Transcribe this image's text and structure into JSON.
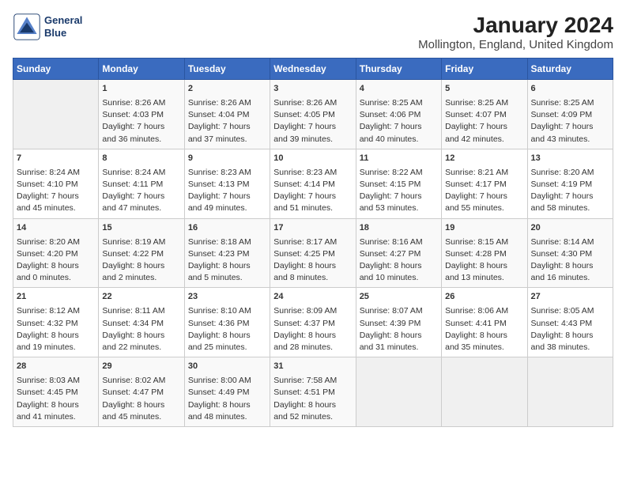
{
  "header": {
    "logo_line1": "General",
    "logo_line2": "Blue",
    "title": "January 2024",
    "subtitle": "Mollington, England, United Kingdom"
  },
  "calendar": {
    "days_of_week": [
      "Sunday",
      "Monday",
      "Tuesday",
      "Wednesday",
      "Thursday",
      "Friday",
      "Saturday"
    ],
    "weeks": [
      [
        {
          "day": "",
          "info": ""
        },
        {
          "day": "1",
          "info": "Sunrise: 8:26 AM\nSunset: 4:03 PM\nDaylight: 7 hours\nand 36 minutes."
        },
        {
          "day": "2",
          "info": "Sunrise: 8:26 AM\nSunset: 4:04 PM\nDaylight: 7 hours\nand 37 minutes."
        },
        {
          "day": "3",
          "info": "Sunrise: 8:26 AM\nSunset: 4:05 PM\nDaylight: 7 hours\nand 39 minutes."
        },
        {
          "day": "4",
          "info": "Sunrise: 8:25 AM\nSunset: 4:06 PM\nDaylight: 7 hours\nand 40 minutes."
        },
        {
          "day": "5",
          "info": "Sunrise: 8:25 AM\nSunset: 4:07 PM\nDaylight: 7 hours\nand 42 minutes."
        },
        {
          "day": "6",
          "info": "Sunrise: 8:25 AM\nSunset: 4:09 PM\nDaylight: 7 hours\nand 43 minutes."
        }
      ],
      [
        {
          "day": "7",
          "info": "Sunrise: 8:24 AM\nSunset: 4:10 PM\nDaylight: 7 hours\nand 45 minutes."
        },
        {
          "day": "8",
          "info": "Sunrise: 8:24 AM\nSunset: 4:11 PM\nDaylight: 7 hours\nand 47 minutes."
        },
        {
          "day": "9",
          "info": "Sunrise: 8:23 AM\nSunset: 4:13 PM\nDaylight: 7 hours\nand 49 minutes."
        },
        {
          "day": "10",
          "info": "Sunrise: 8:23 AM\nSunset: 4:14 PM\nDaylight: 7 hours\nand 51 minutes."
        },
        {
          "day": "11",
          "info": "Sunrise: 8:22 AM\nSunset: 4:15 PM\nDaylight: 7 hours\nand 53 minutes."
        },
        {
          "day": "12",
          "info": "Sunrise: 8:21 AM\nSunset: 4:17 PM\nDaylight: 7 hours\nand 55 minutes."
        },
        {
          "day": "13",
          "info": "Sunrise: 8:20 AM\nSunset: 4:19 PM\nDaylight: 7 hours\nand 58 minutes."
        }
      ],
      [
        {
          "day": "14",
          "info": "Sunrise: 8:20 AM\nSunset: 4:20 PM\nDaylight: 8 hours\nand 0 minutes."
        },
        {
          "day": "15",
          "info": "Sunrise: 8:19 AM\nSunset: 4:22 PM\nDaylight: 8 hours\nand 2 minutes."
        },
        {
          "day": "16",
          "info": "Sunrise: 8:18 AM\nSunset: 4:23 PM\nDaylight: 8 hours\nand 5 minutes."
        },
        {
          "day": "17",
          "info": "Sunrise: 8:17 AM\nSunset: 4:25 PM\nDaylight: 8 hours\nand 8 minutes."
        },
        {
          "day": "18",
          "info": "Sunrise: 8:16 AM\nSunset: 4:27 PM\nDaylight: 8 hours\nand 10 minutes."
        },
        {
          "day": "19",
          "info": "Sunrise: 8:15 AM\nSunset: 4:28 PM\nDaylight: 8 hours\nand 13 minutes."
        },
        {
          "day": "20",
          "info": "Sunrise: 8:14 AM\nSunset: 4:30 PM\nDaylight: 8 hours\nand 16 minutes."
        }
      ],
      [
        {
          "day": "21",
          "info": "Sunrise: 8:12 AM\nSunset: 4:32 PM\nDaylight: 8 hours\nand 19 minutes."
        },
        {
          "day": "22",
          "info": "Sunrise: 8:11 AM\nSunset: 4:34 PM\nDaylight: 8 hours\nand 22 minutes."
        },
        {
          "day": "23",
          "info": "Sunrise: 8:10 AM\nSunset: 4:36 PM\nDaylight: 8 hours\nand 25 minutes."
        },
        {
          "day": "24",
          "info": "Sunrise: 8:09 AM\nSunset: 4:37 PM\nDaylight: 8 hours\nand 28 minutes."
        },
        {
          "day": "25",
          "info": "Sunrise: 8:07 AM\nSunset: 4:39 PM\nDaylight: 8 hours\nand 31 minutes."
        },
        {
          "day": "26",
          "info": "Sunrise: 8:06 AM\nSunset: 4:41 PM\nDaylight: 8 hours\nand 35 minutes."
        },
        {
          "day": "27",
          "info": "Sunrise: 8:05 AM\nSunset: 4:43 PM\nDaylight: 8 hours\nand 38 minutes."
        }
      ],
      [
        {
          "day": "28",
          "info": "Sunrise: 8:03 AM\nSunset: 4:45 PM\nDaylight: 8 hours\nand 41 minutes."
        },
        {
          "day": "29",
          "info": "Sunrise: 8:02 AM\nSunset: 4:47 PM\nDaylight: 8 hours\nand 45 minutes."
        },
        {
          "day": "30",
          "info": "Sunrise: 8:00 AM\nSunset: 4:49 PM\nDaylight: 8 hours\nand 48 minutes."
        },
        {
          "day": "31",
          "info": "Sunrise: 7:58 AM\nSunset: 4:51 PM\nDaylight: 8 hours\nand 52 minutes."
        },
        {
          "day": "",
          "info": ""
        },
        {
          "day": "",
          "info": ""
        },
        {
          "day": "",
          "info": ""
        }
      ]
    ]
  }
}
